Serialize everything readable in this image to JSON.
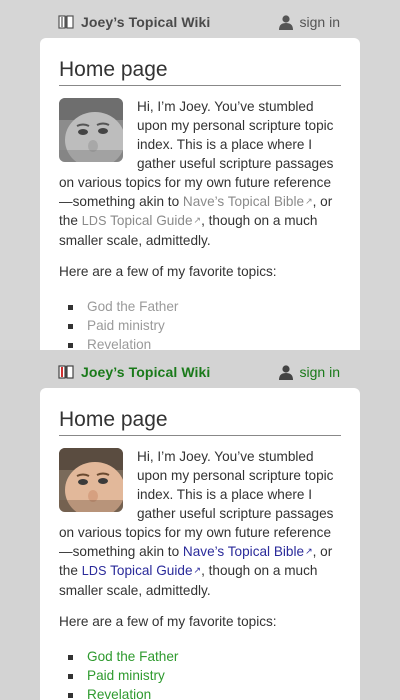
{
  "variants": [
    {
      "name": "grayscale",
      "accent": "#8a8a8a",
      "brand_color": "#4a4a4a"
    },
    {
      "name": "color",
      "accent": "#2a2a9a",
      "brand_color": "#1a7a1a",
      "topic_link_color": "#2e9a2e"
    }
  ],
  "header": {
    "site_title": "Joey’s Topical Wiki",
    "site_icon": "book-icon",
    "signin_label": "sign in",
    "signin_icon": "user-icon"
  },
  "main": {
    "page_title": "Home page",
    "intro": {
      "before_link1": "Hi, I’m Joey. You’ve stumbled upon my personal scripture topic index. This is a place where I gather useful scripture passages on various topics for my own future reference—something akin to ",
      "link1": "Nave’s Topical Bible",
      "between": ", or the ",
      "link2_abbr": "LDS",
      "link2_rest": " Topical Guide",
      "after_link2": ", though on a much smaller scale, admittedly.",
      "external_icon": "↗"
    },
    "favorites_lead": "Here are a few of my favorite topics:",
    "topics": [
      "God the Father",
      "Paid ministry",
      "Revelation"
    ]
  }
}
